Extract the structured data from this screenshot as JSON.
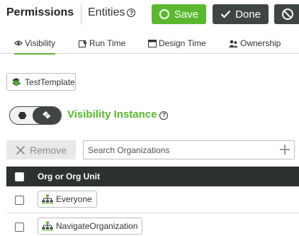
{
  "header": {
    "title": "Permissions",
    "entities_label": "Entities",
    "help_glyph": "?",
    "save_label": "Save",
    "done_label": "Done"
  },
  "tabs": [
    {
      "label": "Visibility",
      "icon": "eye-icon",
      "active": true
    },
    {
      "label": "Run Time",
      "icon": "runtime-icon",
      "active": false
    },
    {
      "label": "Design Time",
      "icon": "design-icon",
      "active": false
    },
    {
      "label": "Ownership",
      "icon": "users-icon",
      "active": false
    }
  ],
  "template": {
    "label": "TestTemplate"
  },
  "visibility": {
    "heading": "Visibility Instance",
    "help_glyph": "?"
  },
  "toolbar": {
    "remove_label": "Remove",
    "search_placeholder": "Search Organizations"
  },
  "table": {
    "column_header": "Org or Org Unit",
    "rows": [
      {
        "label": "Everyone"
      },
      {
        "label": "NavigateOrganization"
      }
    ]
  },
  "colors": {
    "accent": "#5ab82e",
    "dark": "#3f4544",
    "header_bg": "#2c3232"
  }
}
